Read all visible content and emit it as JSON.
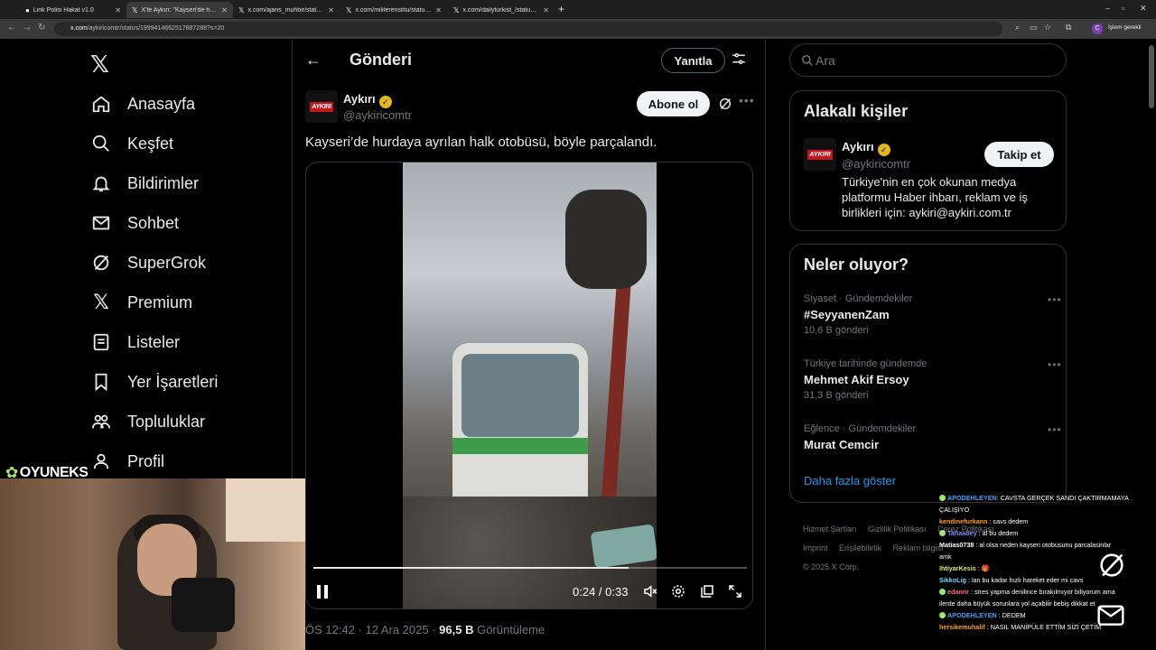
{
  "browser": {
    "tabs": [
      {
        "label": "Link Polisi Hakat v1.0",
        "active": false
      },
      {
        "label": "X'te Aykırı: \"Kayseri'de hurdaya",
        "active": true
      },
      {
        "label": "x.com/ajans_muhbir/status/199",
        "active": false
      },
      {
        "label": "x.com/militerenstitu/status/199",
        "active": false
      },
      {
        "label": "x.com/dailyturkist_/status/199",
        "active": false
      }
    ],
    "url_host": "x.com",
    "url_path": "/aykiricomtr/status/1999414662517887288?s=20",
    "profile_initial": "C",
    "sync_label": "İşlem gerekli"
  },
  "nav": {
    "items": [
      {
        "label": "Anasayfa",
        "icon": "home-icon"
      },
      {
        "label": "Keşfet",
        "icon": "search-icon"
      },
      {
        "label": "Bildirimler",
        "icon": "bell-icon"
      },
      {
        "label": "Sohbet",
        "icon": "mail-icon"
      },
      {
        "label": "SuperGrok",
        "icon": "grok-icon"
      },
      {
        "label": "Premium",
        "icon": "x-icon"
      },
      {
        "label": "Listeler",
        "icon": "list-icon"
      },
      {
        "label": "Yer İşaretleri",
        "icon": "bookmark-icon"
      },
      {
        "label": "Topluluklar",
        "icon": "communities-icon"
      },
      {
        "label": "Profil",
        "icon": "profile-icon"
      }
    ]
  },
  "watermark": "OYUNEKS",
  "post": {
    "page_title": "Gönderi",
    "reply_label": "Yanıtla",
    "author_name": "Aykırı",
    "author_handle": "@aykiricomtr",
    "avatar_text": "AYKIRI",
    "subscribe_label": "Abone ol",
    "text": "Kayseri’de hurdaya ayrılan halk otobüsü, böyle parçalandı.",
    "video": {
      "current_time": "0:24",
      "duration": "0:33",
      "progress": 0.727
    },
    "timestamp": "ÖS 12:42 · 12 Ara 2025 · ",
    "views_value": "96,5 B",
    "views_label": " Görüntüleme"
  },
  "sidebar": {
    "search_placeholder": "Ara",
    "related_title": "Alakalı kişiler",
    "related": {
      "name": "Aykırı",
      "handle": "@aykiricomtr",
      "avatar_text": "AYKIRI",
      "follow_label": "Takip et",
      "bio": "Türkiye'nin en çok okunan medya platformu Haber ihbarı, reklam ve iş birlikleri için: aykiri@aykiri.com.tr"
    },
    "trends_title": "Neler oluyor?",
    "trends": [
      {
        "category": "Siyaset · Gündemdekiler",
        "name": "#SeyyanenZam",
        "count": "10,6 B gönderi"
      },
      {
        "category": "Türkiye tarihinde gündemde",
        "name": "Mehmet Akif Ersoy",
        "count": "31,3 B gönderi"
      },
      {
        "category": "Eğlence · Gündemdekiler",
        "name": "Murat Cemcir",
        "count": ""
      }
    ],
    "show_more": "Daha fazla göster",
    "footer": [
      "Hizmet Şartları",
      "Gizlilik Politikası",
      "Çerez Politikası",
      "Imprint",
      "Erişilebilirlik",
      "Reklam bilgisi",
      "© 2025 X Corp."
    ]
  },
  "chat": [
    {
      "user": "APODEHLEYEN",
      "msg": ": CAVSTA GERÇEK SANDI ÇAKTIRMAMAYA",
      "color": "#3fa0ff",
      "badge": true
    },
    {
      "user": "",
      "msg": "ÇALIŞIYO",
      "color": "#ffffff",
      "badge": false
    },
    {
      "user": "kendinefurkann",
      "msg": " : cavs dedem",
      "color": "#ff9f1c",
      "badge": false
    },
    {
      "user": "Tahaabey",
      "msg": " : al bu dedem",
      "color": "#7d8bff",
      "badge": true
    },
    {
      "user": "Matias0738",
      "msg": " : al olsa neden kayseri otobusunu parcalasinlar",
      "color": "#ffffff",
      "badge": false
    },
    {
      "user": "",
      "msg": "amk",
      "color": "#ffffff",
      "badge": false
    },
    {
      "user": "IhtiyarKesis",
      "msg": " : 🎁",
      "color": "#e6e66b",
      "badge": false
    },
    {
      "user": "SikkoLig",
      "msg": " : lan bu kadar hızlı hareket eder mi cavs",
      "color": "#66d9ff",
      "badge": false
    },
    {
      "user": "edannr",
      "msg": " : stres yapma denilince bırakılmıyor biliyorum ama",
      "color": "#ff6b8a",
      "badge": true
    },
    {
      "user": "",
      "msg": "ilerde daha büyük sorunlara yol açabilir bebiş dikkat et",
      "color": "#ffffff",
      "badge": false
    },
    {
      "user": "APODEHLEYEN",
      "msg": " : DEDEM",
      "color": "#3fa0ff",
      "badge": true
    },
    {
      "user": "hersikemuhalif",
      "msg": " : NASIL MANİPÜLE ETTİM SİZİ ÇETİM",
      "color": "#ff9f1c",
      "badge": false
    }
  ],
  "colors": {
    "background": "#000000",
    "border": "#2f3336",
    "text_primary": "#e7e9ea",
    "text_secondary": "#71767b",
    "accent": "#1d9bf0",
    "verified_gold": "#e2b719"
  }
}
